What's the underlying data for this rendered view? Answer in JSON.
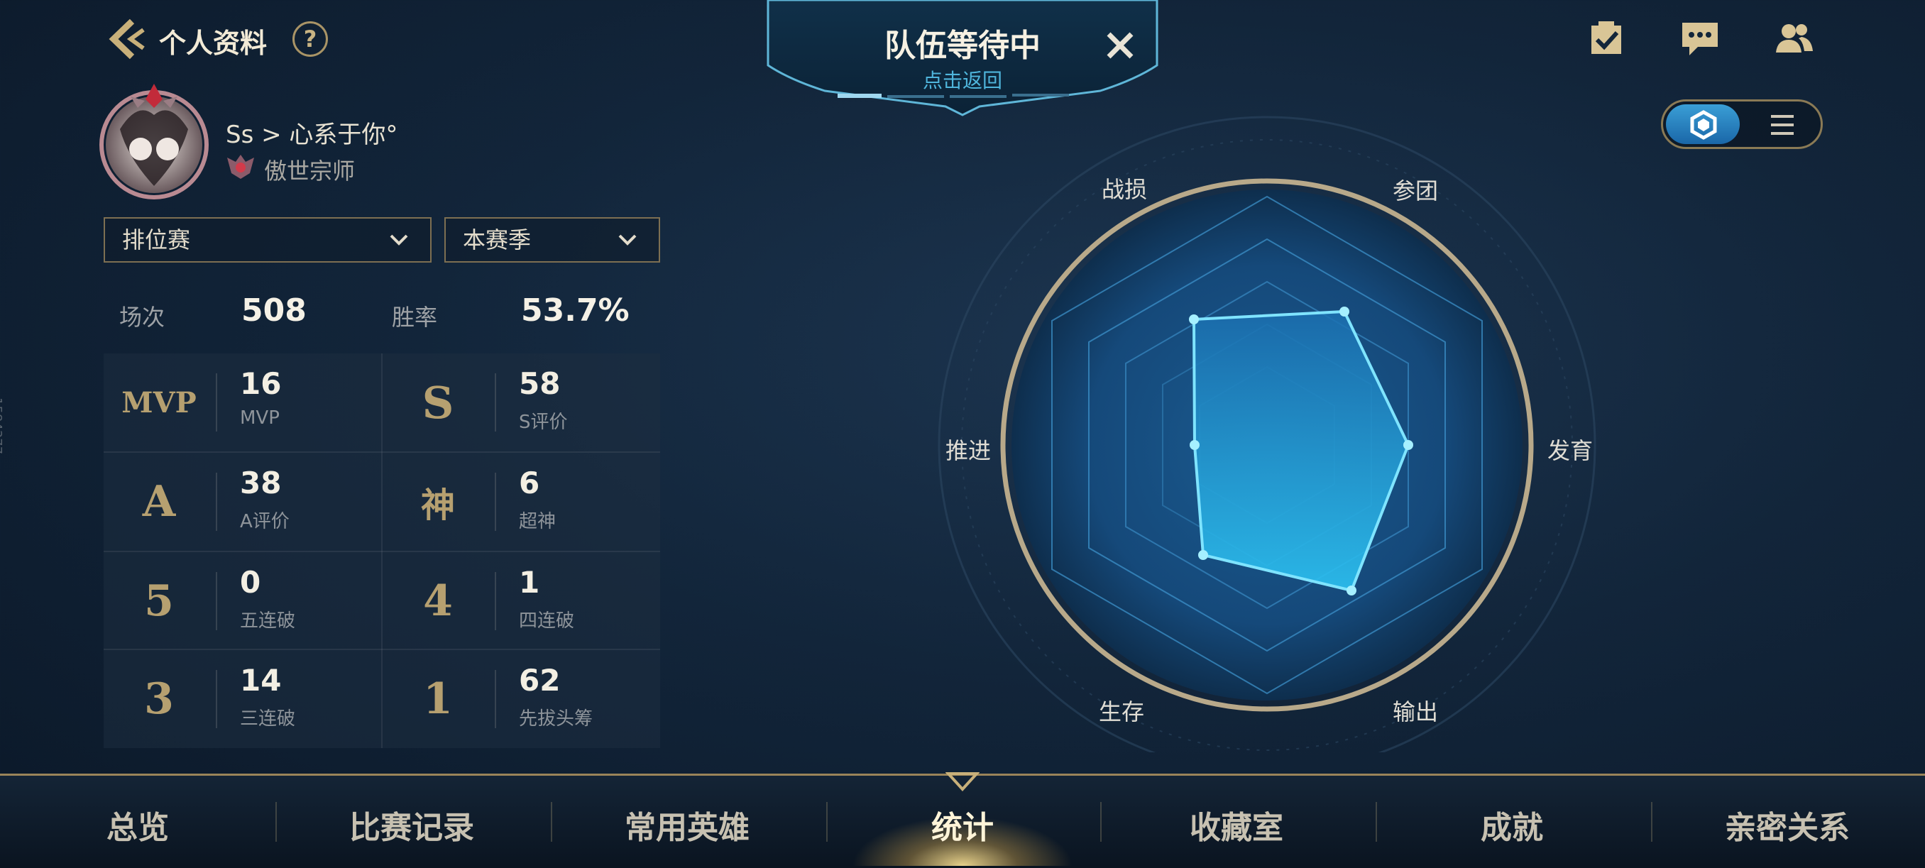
{
  "header": {
    "title": "个人资料",
    "help": "?"
  },
  "profile": {
    "name": "Ss > 心系于你°",
    "rank": "傲世宗师"
  },
  "filters": {
    "mode": "排位赛",
    "season": "本赛季"
  },
  "summary": {
    "matches_label": "场次",
    "matches_value": "508",
    "winrate_label": "胜率",
    "winrate_value": "53.7%"
  },
  "stats": [
    {
      "icon": "MVP",
      "value": "16",
      "label": "MVP"
    },
    {
      "icon": "S",
      "value": "58",
      "label": "S评价"
    },
    {
      "icon": "A",
      "value": "38",
      "label": "A评价"
    },
    {
      "icon": "神",
      "value": "6",
      "label": "超神"
    },
    {
      "icon": "5",
      "value": "0",
      "label": "五连破"
    },
    {
      "icon": "4",
      "value": "1",
      "label": "四连破"
    },
    {
      "icon": "3",
      "value": "14",
      "label": "三连破"
    },
    {
      "icon": "1",
      "value": "62",
      "label": "先拔头筹"
    }
  ],
  "side_id": "1584377",
  "banner": {
    "title": "队伍等待中",
    "subtitle": "点击返回"
  },
  "radar": {
    "labels": {
      "top_left": "战损",
      "top_right": "参团",
      "left": "推进",
      "right": "发育",
      "bottom_left": "生存",
      "bottom_right": "输出"
    }
  },
  "nav": {
    "items": [
      "总览",
      "比赛记录",
      "常用英雄",
      "统计",
      "收藏室",
      "成就",
      "亲密关系"
    ],
    "active": "统计"
  },
  "colors": {
    "accent": "#3aa8e0",
    "gold": "#b6a070"
  }
}
